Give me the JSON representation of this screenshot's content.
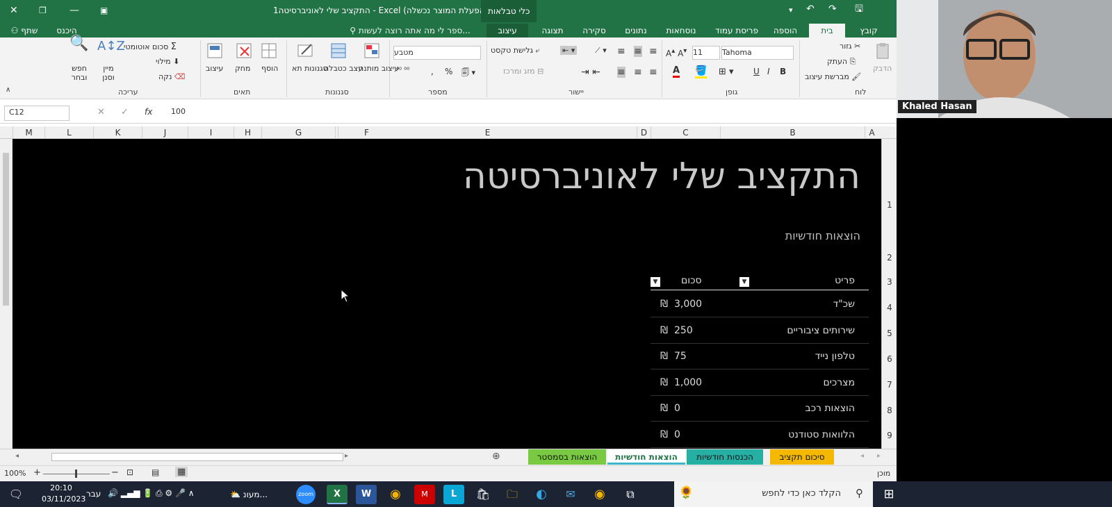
{
  "window": {
    "title": "התקציב שלי לאוניברסיטה1 - Excel (הפעלת המוצר נכשלה)",
    "context_tab": "כלי טבלאות"
  },
  "menu": {
    "tabs": [
      "קובץ",
      "בית",
      "הוספה",
      "פריסת עמוד",
      "נוסחאות",
      "נתונים",
      "סקירה",
      "תצוגה",
      "עיצוב"
    ],
    "active": "בית",
    "tell_me": "ספר לי מה אתה רוצה לעשות...",
    "signin": "היכנס",
    "share": "שתף"
  },
  "ribbon": {
    "clipboard": {
      "label": "לוח",
      "paste": "הדבק",
      "cut": "גזור",
      "copy": "העתק",
      "format_painter": "מברשת עיצוב"
    },
    "font": {
      "label": "גופן",
      "name": "Tahoma",
      "size": "11",
      "bold": "B",
      "italic": "I",
      "underline": "U"
    },
    "alignment": {
      "label": "יישור",
      "wrap": "גלישת טקסט",
      "merge": "מזג ומרכז"
    },
    "number": {
      "label": "מספר",
      "format": "מטבע",
      "percent": "%"
    },
    "styles": {
      "label": "סגנונות",
      "conditional": "עיצוב מותנה",
      "format_table": "עצב כטבלה",
      "cell_styles": "סגנונות תא"
    },
    "cells": {
      "label": "תאים",
      "insert": "הוסף",
      "delete": "מחק",
      "format": "עיצוב"
    },
    "editing": {
      "label": "עריכה",
      "autosum": "סכום אוטומטי",
      "fill": "מילוי",
      "clear": "נקה",
      "sort": "מיין וסנן",
      "find": "חפש ובחר"
    }
  },
  "formula_bar": {
    "name_box": "C12",
    "value": "100",
    "fx": "fx"
  },
  "columns": [
    "A",
    "B",
    "C",
    "D",
    "E",
    "F",
    "G",
    "H",
    "I",
    "J",
    "K",
    "L",
    "M"
  ],
  "rows": [
    "1",
    "2",
    "3",
    "4",
    "5",
    "6",
    "7",
    "8",
    "9"
  ],
  "sheet": {
    "title": "התקציב שלי לאוניברסיטה",
    "subtitle": "הוצאות חודשיות",
    "headers": {
      "item": "פריט",
      "amount": "סכום"
    },
    "items": [
      {
        "name": "שכ\"ד",
        "amount": "3,000",
        "currency": "₪"
      },
      {
        "name": "שירותים ציבוריים",
        "amount": "250",
        "currency": "₪"
      },
      {
        "name": "טלפון נייד",
        "amount": "75",
        "currency": "₪"
      },
      {
        "name": "מצרכים",
        "amount": "1,000",
        "currency": "₪"
      },
      {
        "name": "הוצאות רכב",
        "amount": "0",
        "currency": "₪"
      },
      {
        "name": "הלוואות סטודנט",
        "amount": "0",
        "currency": "₪"
      }
    ]
  },
  "sheet_tabs": [
    {
      "label": "סיכום תקציב",
      "color": "#f5b800"
    },
    {
      "label": "הכנסות חודשיות",
      "color": "#26b0a4"
    },
    {
      "label": "הוצאות חודשיות",
      "color": "#3cb7c9",
      "active": true
    },
    {
      "label": "הוצאות בסמסטר",
      "color": "#7ac943"
    }
  ],
  "status": {
    "ready": "מוכן",
    "zoom": "100%"
  },
  "video": {
    "name": "Khaled Hasan"
  },
  "taskbar": {
    "search": "הקלד כאן כדי לחפש",
    "time": "20:10",
    "date": "03/11/2023",
    "lang": "עבר",
    "app_label": "מעונ..."
  }
}
